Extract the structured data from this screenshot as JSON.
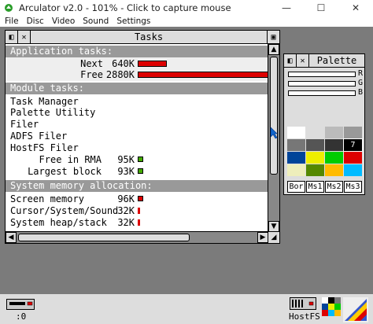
{
  "window": {
    "title": "Arculator v2.0 - 101% - Click to capture mouse",
    "minimize_glyph": "—",
    "maximize_glyph": "☐",
    "close_glyph": "✕"
  },
  "menu": [
    "File",
    "Disc",
    "Video",
    "Sound",
    "Settings"
  ],
  "tasks_window": {
    "title": "Tasks",
    "application_tasks": {
      "header": "Application tasks:",
      "rows": [
        {
          "label": "Next",
          "value": "640K",
          "fraction": 0.22
        },
        {
          "label": "Free",
          "value": "2880K",
          "fraction": 1.0
        }
      ]
    },
    "module_tasks": {
      "header": "Module tasks:",
      "items": [
        "Task Manager",
        "Palette Utility",
        "Filer",
        "ADFS Filer",
        "HostFS Filer"
      ],
      "rows": [
        {
          "label": "Free in RMA",
          "value": "95K",
          "indicator": "green"
        },
        {
          "label": "Largest block",
          "value": "93K",
          "indicator": "green"
        }
      ]
    },
    "system_memory": {
      "header": "System memory allocation:",
      "rows": [
        {
          "label": "Screen memory",
          "value": "96K",
          "indicator": "red"
        },
        {
          "label": "Cursor/System/Sound",
          "value": "32K",
          "indicator": "tick"
        },
        {
          "label": "System heap/stack",
          "value": "32K",
          "indicator": "tick"
        }
      ]
    }
  },
  "palette_window": {
    "title": "Palette",
    "channels": [
      "R",
      "G",
      "B"
    ],
    "swatches": [
      "#ffffff",
      "#dddddd",
      "#bbbbbb",
      "#999999",
      "#777777",
      "#555555",
      "#333333",
      "#000000",
      "#004499",
      "#eeee00",
      "#00cc00",
      "#dd0000",
      "#eeeebb",
      "#558800",
      "#ffbb00",
      "#00bbff"
    ],
    "selected_swatch_label": "7",
    "buttons": [
      "Bor",
      "Ms1",
      "Ms2",
      "Ms3"
    ]
  },
  "iconbar": {
    "drive_label": ":0",
    "hostfs_label": "HostFS"
  },
  "colors": {
    "desktop": "#7b7b7b",
    "window_bg": "#dddddd",
    "section_header": "#999999",
    "bar_red": "#dd0000",
    "indicator_green": "#44aa00"
  }
}
